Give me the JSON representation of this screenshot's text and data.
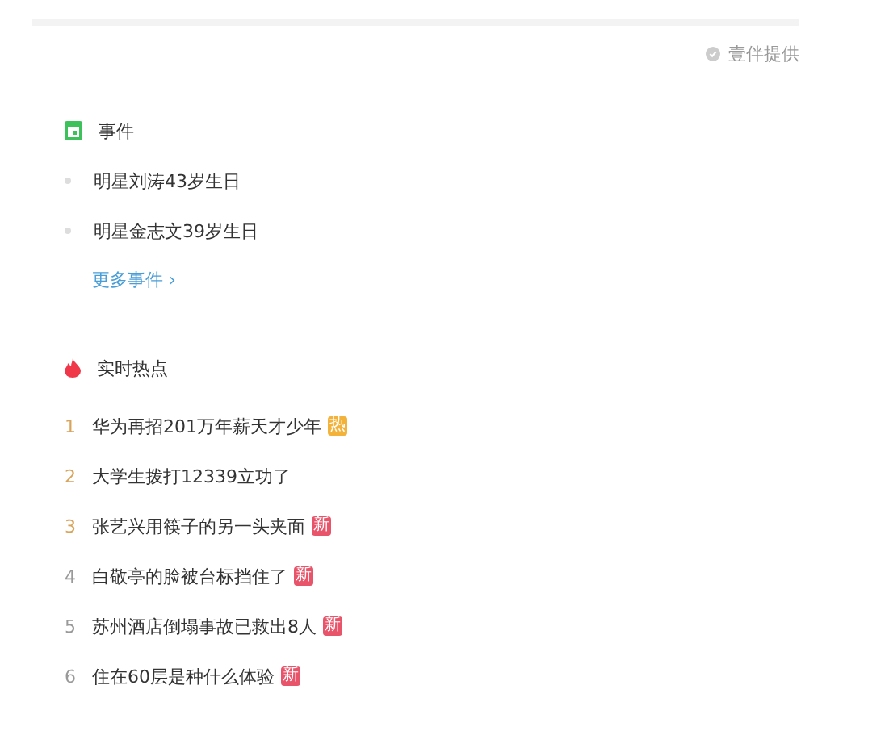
{
  "provider": {
    "label": "壹伴提供"
  },
  "events": {
    "title": "事件",
    "items": [
      "明星刘涛43岁生日",
      "明星金志文39岁生日"
    ],
    "more_link": "更多事件 ›"
  },
  "hot": {
    "title": "实时热点",
    "items": [
      {
        "rank": "1",
        "top": true,
        "text": "华为再招201万年薪天才少年",
        "badge": {
          "kind": "hot",
          "label": "热"
        }
      },
      {
        "rank": "2",
        "top": true,
        "text": "大学生拨打12339立功了"
      },
      {
        "rank": "3",
        "top": true,
        "text": "张艺兴用筷子的另一头夹面",
        "badge": {
          "kind": "new",
          "label": "新"
        }
      },
      {
        "rank": "4",
        "top": false,
        "text": "白敬亭的脸被台标挡住了",
        "badge": {
          "kind": "new",
          "label": "新"
        }
      },
      {
        "rank": "5",
        "top": false,
        "text": "苏州酒店倒塌事故已救出8人",
        "badge": {
          "kind": "new",
          "label": "新"
        }
      },
      {
        "rank": "6",
        "top": false,
        "text": "住在60层是种什么体验",
        "badge": {
          "kind": "new",
          "label": "新"
        }
      }
    ]
  }
}
